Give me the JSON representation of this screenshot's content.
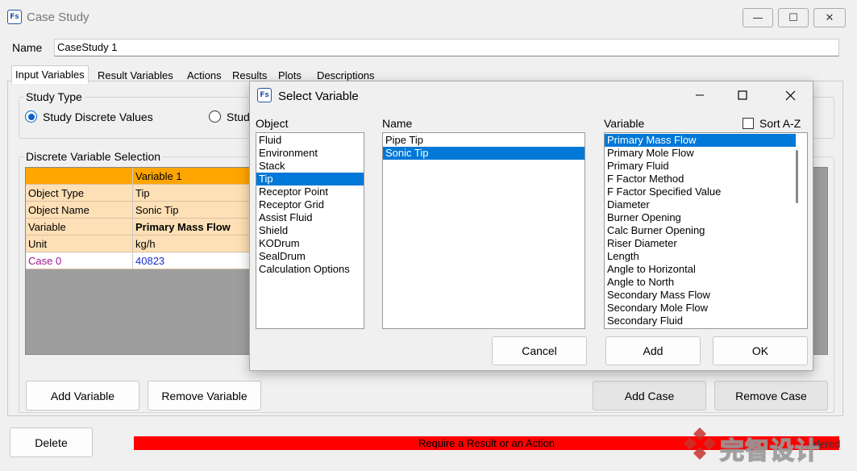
{
  "window": {
    "title": "Case Study",
    "logo": "Fs",
    "minimize": "—",
    "maximize": "☐",
    "close": "✕"
  },
  "name_field": {
    "label": "Name",
    "value": "CaseStudy 1"
  },
  "tabs": [
    {
      "label": "Input Variables"
    },
    {
      "label": "Result Variables"
    },
    {
      "label": "Actions"
    },
    {
      "label": "Results"
    },
    {
      "label": "Plots"
    },
    {
      "label": "Descriptions"
    }
  ],
  "study_type": {
    "label": "Study Type",
    "option1": "Study Discrete Values",
    "option2": "Stud"
  },
  "discrete": {
    "label": "Discrete Variable Selection",
    "col_header": "Variable 1",
    "rows": [
      {
        "label": "Object Type",
        "value": "Tip"
      },
      {
        "label": "Object Name",
        "value": "Sonic Tip"
      },
      {
        "label": "Variable",
        "value": "Primary Mass Flow"
      },
      {
        "label": "Unit",
        "value": "kg/h"
      }
    ],
    "case": {
      "label": "Case 0",
      "value": "40823"
    }
  },
  "buttons": {
    "add_variable": "Add Variable",
    "remove_variable": "Remove Variable",
    "add_case": "Add Case",
    "remove_case": "Remove Case",
    "delete": "Delete"
  },
  "status": {
    "text": "Require a Result or an Action",
    "color": "#ff0000"
  },
  "watermark": {
    "text": "完智设计",
    "tail": "ndered"
  },
  "dialog": {
    "title": "Select Variable",
    "logo": "Fs",
    "object_label": "Object",
    "name_label": "Name",
    "variable_label": "Variable",
    "sort_label": "Sort A-Z",
    "objects": [
      "Fluid",
      "Environment",
      "Stack",
      "Tip",
      "Receptor Point",
      "Receptor Grid",
      "Assist Fluid",
      "Shield",
      "KODrum",
      "SealDrum",
      "Calculation Options"
    ],
    "selected_object": "Tip",
    "names": [
      "Pipe Tip",
      "Sonic Tip"
    ],
    "selected_name": "Sonic Tip",
    "variables": [
      "Primary Mass Flow",
      "Primary Mole Flow",
      "Primary Fluid",
      "F Factor Method",
      "F Factor Specified Value",
      "Diameter",
      "Burner Opening",
      "Calc Burner Opening",
      "Riser Diameter",
      "Length",
      "Angle to Horizontal",
      "Angle to North",
      "Secondary Mass Flow",
      "Secondary Mole Flow",
      "Secondary Fluid"
    ],
    "selected_variable": "Primary Mass Flow",
    "cancel": "Cancel",
    "add": "Add",
    "ok": "OK"
  },
  "colors": {
    "accent": "#0078d7",
    "header": "#ffa500",
    "row": "#fde0b6"
  }
}
